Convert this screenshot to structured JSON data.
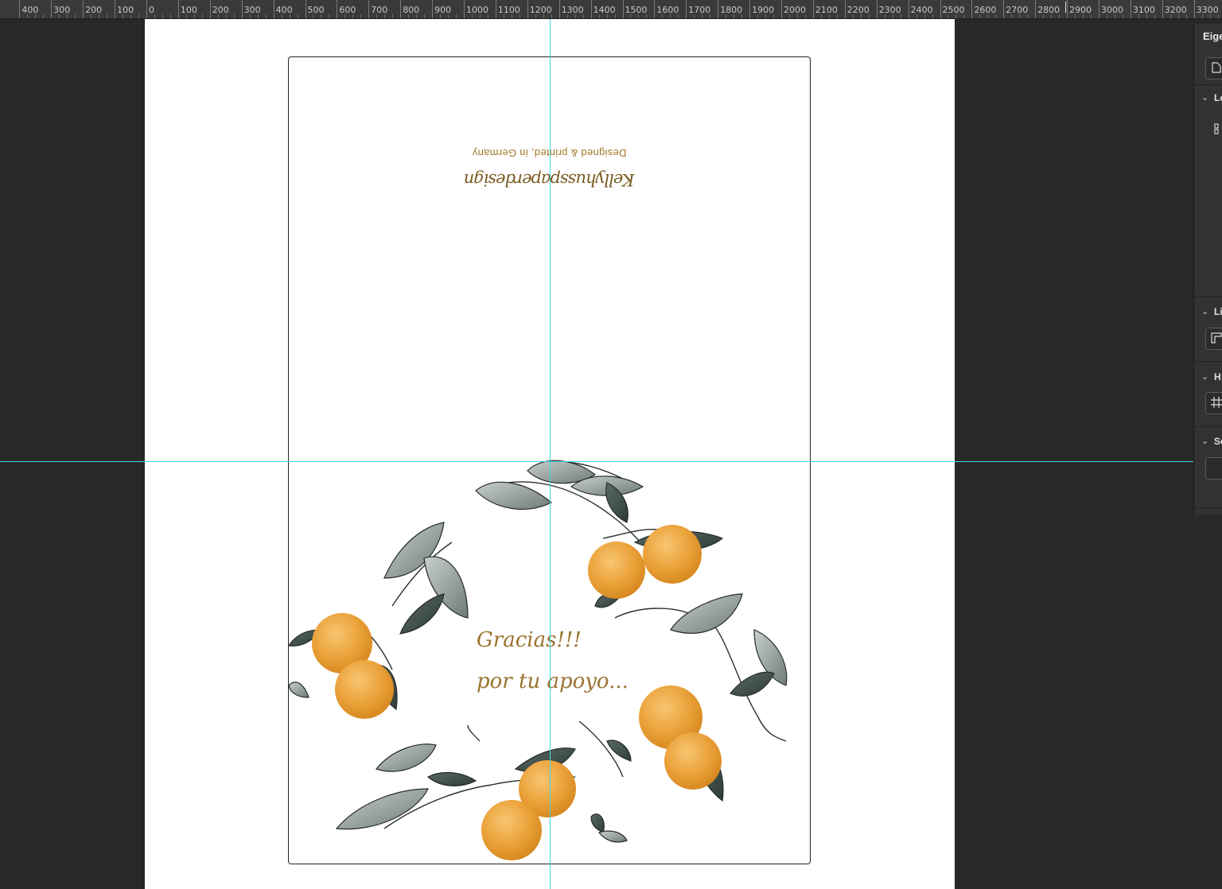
{
  "ruler": {
    "labels": [
      "400",
      "300",
      "200",
      "100",
      "0",
      "100",
      "200",
      "300",
      "400",
      "500",
      "600",
      "700",
      "800",
      "900",
      "1000",
      "1100",
      "1200",
      "1300",
      "1400",
      "1500",
      "1600",
      "1700",
      "1800",
      "1900",
      "2000",
      "2100",
      "2200",
      "2300",
      "2400",
      "2500",
      "2600",
      "2700",
      "2800",
      "2900",
      "3000",
      "3100",
      "3200",
      "3300"
    ]
  },
  "card": {
    "back": {
      "line1": "Designed & printed, in Germany",
      "signature": "Kellyhusspaperdesign"
    },
    "front": {
      "greeting1": "Gracias!!!",
      "greeting2": "por tu apoyo..."
    }
  },
  "panel": {
    "title": "Eige",
    "sections": [
      {
        "label": "Lo"
      },
      {
        "label": "Li"
      },
      {
        "label": "H"
      },
      {
        "label": "Sc"
      }
    ]
  },
  "colors": {
    "guide": "#3fd6e0",
    "orange": "#e89a2e",
    "leaf": "#6f7d78",
    "text_gold": "#a0782a"
  }
}
